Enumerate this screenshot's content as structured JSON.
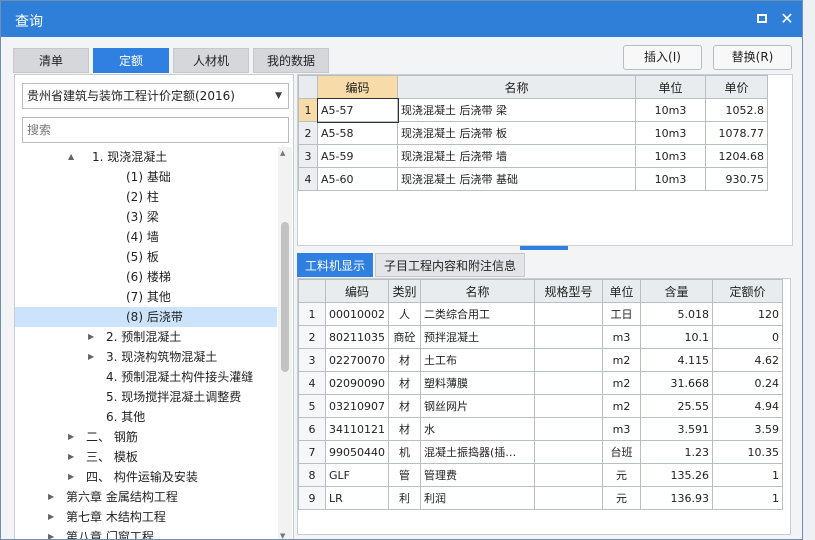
{
  "window": {
    "title": "查询"
  },
  "tabs": [
    "清单",
    "定额",
    "人材机",
    "我的数据"
  ],
  "active_tab": "定额",
  "buttons": {
    "insert": "插入(I)",
    "replace": "替换(R)"
  },
  "library": {
    "selected": "贵州省建筑与装饰工程计价定额(2016)",
    "search_placeholder": "搜索"
  },
  "tree": [
    {
      "label": "1. 现浇混凝土",
      "toggle": "▲"
    },
    {
      "label": "(1) 基础",
      "toggle": ""
    },
    {
      "label": "(2) 柱",
      "toggle": ""
    },
    {
      "label": "(3) 梁",
      "toggle": ""
    },
    {
      "label": "(4) 墙",
      "toggle": ""
    },
    {
      "label": "(5) 板",
      "toggle": ""
    },
    {
      "label": "(6) 楼梯",
      "toggle": ""
    },
    {
      "label": "(7) 其他",
      "toggle": ""
    },
    {
      "label": "(8) 后浇带",
      "toggle": ""
    },
    {
      "label": "2. 预制混凝土",
      "toggle": "▶"
    },
    {
      "label": "3. 现浇构筑物混凝土",
      "toggle": "▶"
    },
    {
      "label": "4. 预制混凝土构件接头灌缝",
      "toggle": ""
    },
    {
      "label": "5. 现场搅拌混凝土调整费",
      "toggle": ""
    },
    {
      "label": "6. 其他",
      "toggle": ""
    },
    {
      "label": "二、 钢筋",
      "toggle": "▶"
    },
    {
      "label": "三、 模板",
      "toggle": "▶"
    },
    {
      "label": "四、 构件运输及安装",
      "toggle": "▶"
    },
    {
      "label": "第六章 金属结构工程",
      "toggle": "▶"
    },
    {
      "label": "第七章 木结构工程",
      "toggle": "▶"
    },
    {
      "label": "第八章 门窗工程",
      "toggle": "▶"
    }
  ],
  "quota_table": {
    "headers": [
      "编码",
      "名称",
      "单位",
      "单价"
    ],
    "rows": [
      {
        "n": "1",
        "code": "A5-57",
        "name": "现浇混凝土 后浇带 梁",
        "unit": "10m3",
        "price": "1052.8"
      },
      {
        "n": "2",
        "code": "A5-58",
        "name": "现浇混凝土 后浇带 板",
        "unit": "10m3",
        "price": "1078.77"
      },
      {
        "n": "3",
        "code": "A5-59",
        "name": "现浇混凝土 后浇带 墙",
        "unit": "10m3",
        "price": "1204.68"
      },
      {
        "n": "4",
        "code": "A5-60",
        "name": "现浇混凝土 后浇带 基础",
        "unit": "10m3",
        "price": "930.75"
      }
    ]
  },
  "bottom_tabs": [
    "工料机显示",
    "子目工程内容和附注信息"
  ],
  "resource_table": {
    "headers": [
      "编码",
      "类别",
      "名称",
      "规格型号",
      "单位",
      "含量",
      "定额价"
    ],
    "rows": [
      {
        "n": "1",
        "code": "00010002",
        "cat": "人",
        "name": "二类综合用工",
        "spec": "",
        "unit": "工日",
        "qty": "5.018",
        "price": "120"
      },
      {
        "n": "2",
        "code": "80211035",
        "cat": "商砼",
        "name": "预拌混凝土",
        "spec": "",
        "unit": "m3",
        "qty": "10.1",
        "price": "0"
      },
      {
        "n": "3",
        "code": "02270070",
        "cat": "材",
        "name": "土工布",
        "spec": "",
        "unit": "m2",
        "qty": "4.115",
        "price": "4.62"
      },
      {
        "n": "4",
        "code": "02090090",
        "cat": "材",
        "name": "塑料薄膜",
        "spec": "",
        "unit": "m2",
        "qty": "31.668",
        "price": "0.24"
      },
      {
        "n": "5",
        "code": "03210907",
        "cat": "材",
        "name": "钢丝网片",
        "spec": "",
        "unit": "m2",
        "qty": "25.55",
        "price": "4.94"
      },
      {
        "n": "6",
        "code": "34110121",
        "cat": "材",
        "name": "水",
        "spec": "",
        "unit": "m3",
        "qty": "3.591",
        "price": "3.59"
      },
      {
        "n": "7",
        "code": "99050440",
        "cat": "机",
        "name": "混凝土振捣器(插…",
        "spec": "",
        "unit": "台班",
        "qty": "1.23",
        "price": "10.35"
      },
      {
        "n": "8",
        "code": "GLF",
        "cat": "管",
        "name": "管理费",
        "spec": "",
        "unit": "元",
        "qty": "135.26",
        "price": "1"
      },
      {
        "n": "9",
        "code": "LR",
        "cat": "利",
        "name": "利润",
        "spec": "",
        "unit": "元",
        "qty": "136.93",
        "price": "1"
      }
    ]
  },
  "colors": {
    "accent": "#2f80e0",
    "titlebar": "#2f7fd8",
    "selection": "#cce4fb",
    "header_highlight": "#f7dcaa"
  }
}
